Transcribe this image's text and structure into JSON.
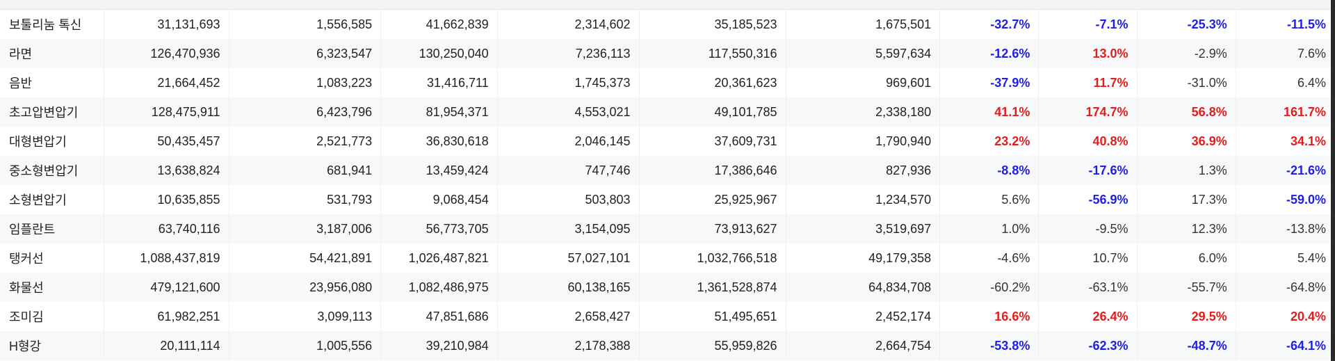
{
  "rows": [
    {
      "name": "보툴리눔 톡신",
      "c1": "31,131,693",
      "c2": "1,556,585",
      "c3": "41,662,839",
      "c4": "2,314,602",
      "c5": "35,185,523",
      "c6": "1,675,501",
      "p1": "-32.7%",
      "p2": "-7.1%",
      "p3": "-25.3%",
      "p4": "-11.5%",
      "s": [
        "neg",
        "neg",
        "neg",
        "neg"
      ]
    },
    {
      "name": "라면",
      "c1": "126,470,936",
      "c2": "6,323,547",
      "c3": "130,250,040",
      "c4": "7,236,113",
      "c5": "117,550,316",
      "c6": "5,597,634",
      "p1": "-12.6%",
      "p2": "13.0%",
      "p3": "-2.9%",
      "p4": "7.6%",
      "s": [
        "neg",
        "pos",
        "plain",
        "plain"
      ]
    },
    {
      "name": "음반",
      "c1": "21,664,452",
      "c2": "1,083,223",
      "c3": "31,416,711",
      "c4": "1,745,373",
      "c5": "20,361,623",
      "c6": "969,601",
      "p1": "-37.9%",
      "p2": "11.7%",
      "p3": "-31.0%",
      "p4": "6.4%",
      "s": [
        "neg",
        "pos",
        "plain",
        "plain"
      ]
    },
    {
      "name": "초고압변압기",
      "c1": "128,475,911",
      "c2": "6,423,796",
      "c3": "81,954,371",
      "c4": "4,553,021",
      "c5": "49,101,785",
      "c6": "2,338,180",
      "p1": "41.1%",
      "p2": "174.7%",
      "p3": "56.8%",
      "p4": "161.7%",
      "s": [
        "pos",
        "pos",
        "pos",
        "pos"
      ]
    },
    {
      "name": "대형변압기",
      "c1": "50,435,457",
      "c2": "2,521,773",
      "c3": "36,830,618",
      "c4": "2,046,145",
      "c5": "37,609,731",
      "c6": "1,790,940",
      "p1": "23.2%",
      "p2": "40.8%",
      "p3": "36.9%",
      "p4": "34.1%",
      "s": [
        "pos",
        "pos",
        "pos",
        "pos"
      ]
    },
    {
      "name": "중소형변압기",
      "c1": "13,638,824",
      "c2": "681,941",
      "c3": "13,459,424",
      "c4": "747,746",
      "c5": "17,386,646",
      "c6": "827,936",
      "p1": "-8.8%",
      "p2": "-17.6%",
      "p3": "1.3%",
      "p4": "-21.6%",
      "s": [
        "neg",
        "neg",
        "plain",
        "neg"
      ]
    },
    {
      "name": "소형변압기",
      "c1": "10,635,855",
      "c2": "531,793",
      "c3": "9,068,454",
      "c4": "503,803",
      "c5": "25,925,967",
      "c6": "1,234,570",
      "p1": "5.6%",
      "p2": "-56.9%",
      "p3": "17.3%",
      "p4": "-59.0%",
      "s": [
        "plain",
        "neg",
        "plain",
        "neg"
      ]
    },
    {
      "name": "임플란트",
      "c1": "63,740,116",
      "c2": "3,187,006",
      "c3": "56,773,705",
      "c4": "3,154,095",
      "c5": "73,913,627",
      "c6": "3,519,697",
      "p1": "1.0%",
      "p2": "-9.5%",
      "p3": "12.3%",
      "p4": "-13.8%",
      "s": [
        "plain",
        "plain",
        "plain",
        "plain"
      ]
    },
    {
      "name": "탱커선",
      "c1": "1,088,437,819",
      "c2": "54,421,891",
      "c3": "1,026,487,821",
      "c4": "57,027,101",
      "c5": "1,032,766,518",
      "c6": "49,179,358",
      "p1": "-4.6%",
      "p2": "10.7%",
      "p3": "6.0%",
      "p4": "5.4%",
      "s": [
        "plain",
        "plain",
        "plain",
        "plain"
      ]
    },
    {
      "name": "화물선",
      "c1": "479,121,600",
      "c2": "23,956,080",
      "c3": "1,082,486,975",
      "c4": "60,138,165",
      "c5": "1,361,528,874",
      "c6": "64,834,708",
      "p1": "-60.2%",
      "p2": "-63.1%",
      "p3": "-55.7%",
      "p4": "-64.8%",
      "s": [
        "plain",
        "plain",
        "plain",
        "plain"
      ]
    },
    {
      "name": "조미김",
      "c1": "61,982,251",
      "c2": "3,099,113",
      "c3": "47,851,686",
      "c4": "2,658,427",
      "c5": "51,495,651",
      "c6": "2,452,174",
      "p1": "16.6%",
      "p2": "26.4%",
      "p3": "29.5%",
      "p4": "20.4%",
      "s": [
        "pos",
        "pos",
        "pos",
        "pos"
      ]
    },
    {
      "name": "H형강",
      "c1": "20,111,114",
      "c2": "1,005,556",
      "c3": "39,210,984",
      "c4": "2,178,388",
      "c5": "55,959,826",
      "c6": "2,664,754",
      "p1": "-53.8%",
      "p2": "-62.3%",
      "p3": "-48.7%",
      "p4": "-64.1%",
      "s": [
        "neg",
        "neg",
        "neg",
        "neg"
      ]
    }
  ],
  "colors": {
    "negative": "#1d1ee6",
    "positive": "#e31c1c",
    "text": "#222222"
  }
}
